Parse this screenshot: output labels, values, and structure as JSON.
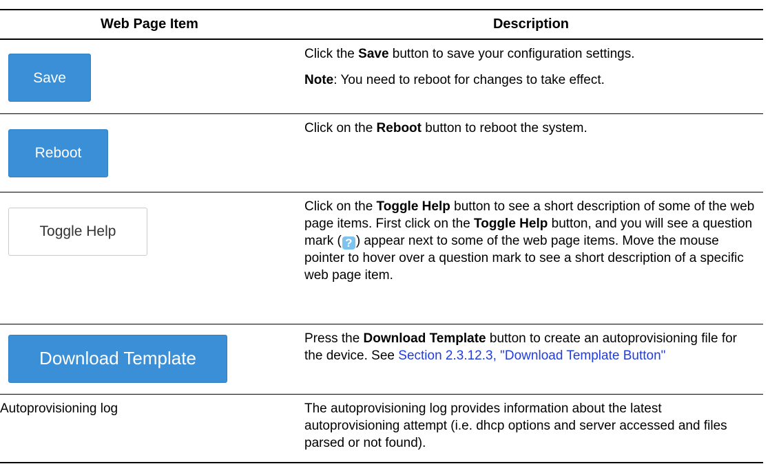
{
  "table": {
    "headers": [
      "Web Page Item",
      "Description"
    ],
    "rows": [
      {
        "button": "Save",
        "desc": {
          "p1": [
            "Click the ",
            "Save",
            " button to save your configuration settings."
          ],
          "note_label": "Note",
          "note_text": ": You need to reboot for changes to take effect."
        }
      },
      {
        "button": "Reboot",
        "desc": [
          "Click on the ",
          "Reboot",
          " button to reboot the system."
        ]
      },
      {
        "button": "Toggle Help",
        "desc": [
          "Click on the ",
          "Toggle Help",
          " button to see a short description of some of the web page items. First click on the ",
          "Toggle Help",
          " button, and you will see a question mark (",
          "?",
          ") appear next to some of the web page items. Move the mouse pointer to hover over a question mark to see a short description of a specific web page item."
        ]
      },
      {
        "button": "Download Template",
        "desc": [
          "Press the ",
          "Download Template",
          " button to create an autoprovisioning file for the device. See ",
          "Section 2.3.12.3, \"Download Template Button\""
        ]
      },
      {
        "item": "Autoprovisioning log",
        "desc": "The autoprovisioning log provides information about the latest autoprovisioning attempt (i.e. dhcp options and server accessed and files parsed or not found)."
      }
    ]
  },
  "colors": {
    "primary_button": "#3a8fd6",
    "help_icon": "#7cc3ef",
    "link": "#1e3ce0"
  },
  "icons": [
    "help-question-icon"
  ]
}
